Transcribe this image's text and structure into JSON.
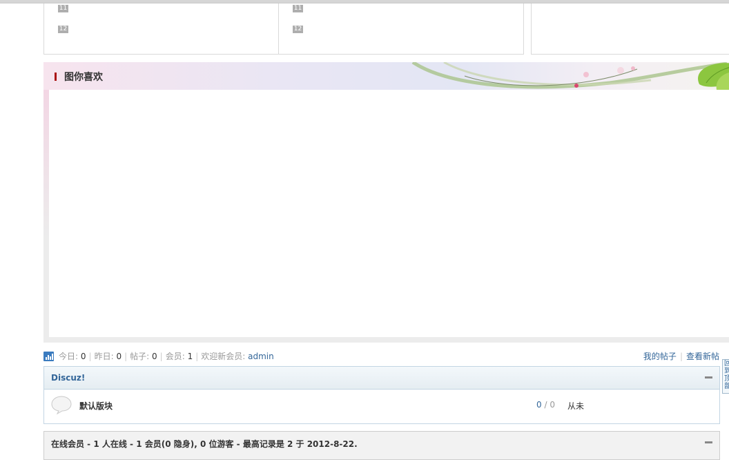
{
  "top_boxes": {
    "left_ranks": [
      "11",
      "12"
    ],
    "mid_ranks": [
      "11",
      "12"
    ]
  },
  "likes": {
    "title": "图你喜欢"
  },
  "stats": {
    "today_label": "今日:",
    "today_value": "0",
    "yesterday_label": "昨日:",
    "yesterday_value": "0",
    "posts_label": "帖子:",
    "posts_value": "0",
    "members_label": "会员:",
    "members_value": "1",
    "welcome_label": "欢迎新会员:",
    "new_member": "admin"
  },
  "links": {
    "my_posts": "我的帖子",
    "new_posts": "查看新帖"
  },
  "forum_group": {
    "title": "Discuz!",
    "forum_name": "默认版块",
    "threads": "0",
    "posts": "0",
    "last_post": "从未"
  },
  "online": {
    "text": "在线会员 - 1 人在线 - 1 会员(0 隐身), 0 位游客 - 最高记录是 2 于 2012-8-22."
  },
  "back_to_top": {
    "label": "回到顶部"
  },
  "colors": {
    "link": "#336699",
    "accent_bar": "#aa1111",
    "group_border": "#c2d5e3"
  }
}
